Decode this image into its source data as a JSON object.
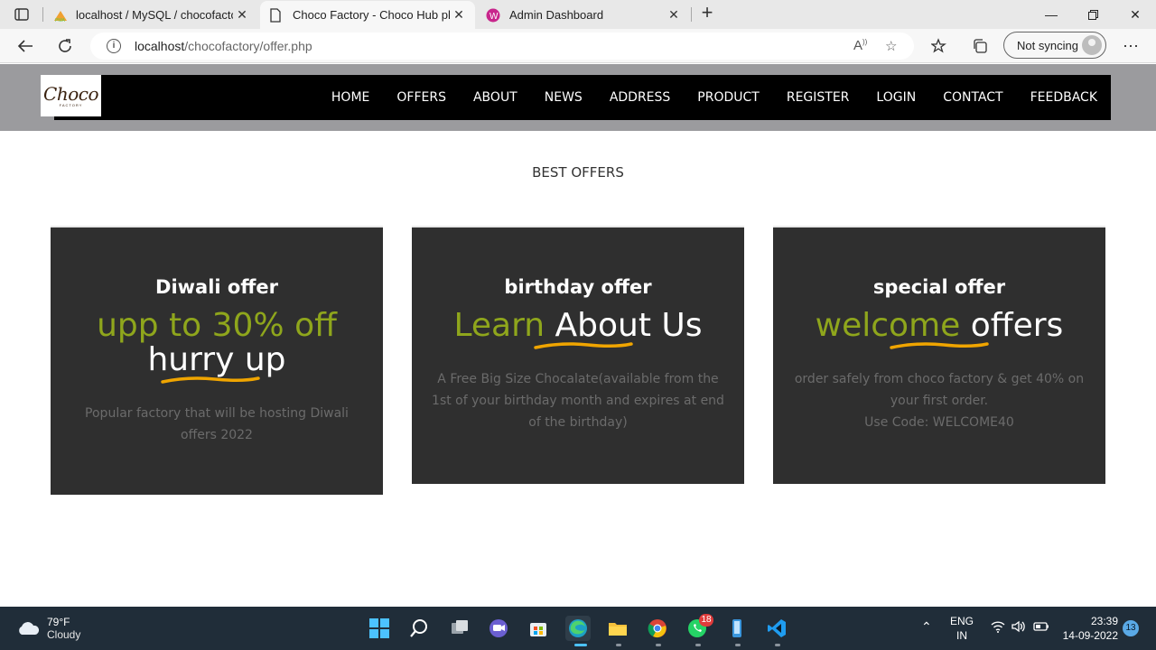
{
  "browser": {
    "tabs": [
      {
        "title": "localhost / MySQL / chocofactory",
        "favicon": "phpmyadmin-icon"
      },
      {
        "title": "Choco Factory - Choco Hub php",
        "favicon": "page-icon",
        "active": true
      },
      {
        "title": "Admin Dashboard",
        "favicon": "dashboard-icon"
      }
    ],
    "url_host": "localhost",
    "url_path": "/chocofactory/offer.php",
    "sync_label": "Not syncing"
  },
  "site": {
    "logo_text": "Choco",
    "logo_sub": "FACTORY",
    "nav": [
      "HOME",
      "OFFERS",
      "ABOUT",
      "NEWS",
      "ADDRESS",
      "PRODUCT",
      "REGISTER",
      "LOGIN",
      "CONTACT",
      "FEEDBACK"
    ],
    "section_title": "BEST OFFERS",
    "cards": [
      {
        "title": "Diwali offer",
        "head_green": "upp to 30% off",
        "head_white": "hurry up",
        "desc": "Popular factory that will be hosting Diwali offers 2022"
      },
      {
        "title": "birthday offer",
        "head_green": "Learn",
        "head_white": "About Us",
        "desc": "A Free Big Size Chocalate(available from the 1st of your birthday month and expires at end of the birthday)"
      },
      {
        "title": "special offer",
        "head_green": "welcome",
        "head_white": "offers",
        "desc": "order safely from choco factory & get 40% on your first order.",
        "desc2": "Use Code: WELCOME40"
      }
    ],
    "colors": {
      "green": "#8fa61c",
      "card_bg": "#2f2f2f",
      "nav_bg": "#000000",
      "underline": "#f0a500"
    }
  },
  "taskbar": {
    "weather_temp": "79°F",
    "weather_text": "Cloudy",
    "lang": "ENG",
    "region": "IN",
    "time": "23:39",
    "date": "14-09-2022",
    "notifications": "13",
    "whatsapp_badge": "18"
  }
}
